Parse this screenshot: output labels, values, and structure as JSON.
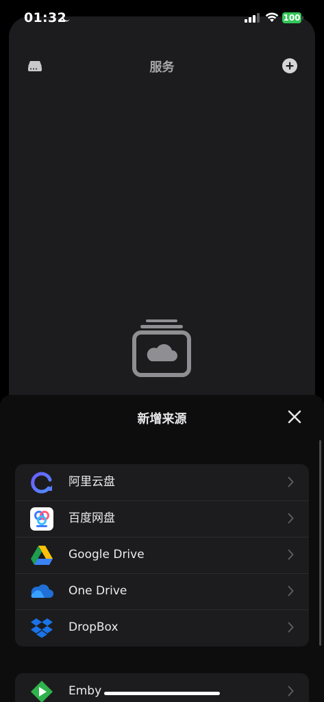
{
  "status_bar": {
    "time": "01:32",
    "battery": "100"
  },
  "header": {
    "title": "服务"
  },
  "sheet": {
    "title": "新增来源",
    "sources": [
      {
        "label": "阿里云盘",
        "icon": "aliyun-drive-icon"
      },
      {
        "label": "百度网盘",
        "icon": "baidu-netdisk-icon"
      },
      {
        "label": "Google Drive",
        "icon": "google-drive-icon"
      },
      {
        "label": "One Drive",
        "icon": "onedrive-icon"
      },
      {
        "label": "DropBox",
        "icon": "dropbox-icon"
      }
    ],
    "media_servers": [
      {
        "label": "Emby",
        "icon": "emby-icon"
      }
    ]
  },
  "colors": {
    "background": "#000000",
    "card": "#1c1c1e",
    "sheet": "#0d0d0e",
    "battery": "#34c759"
  }
}
